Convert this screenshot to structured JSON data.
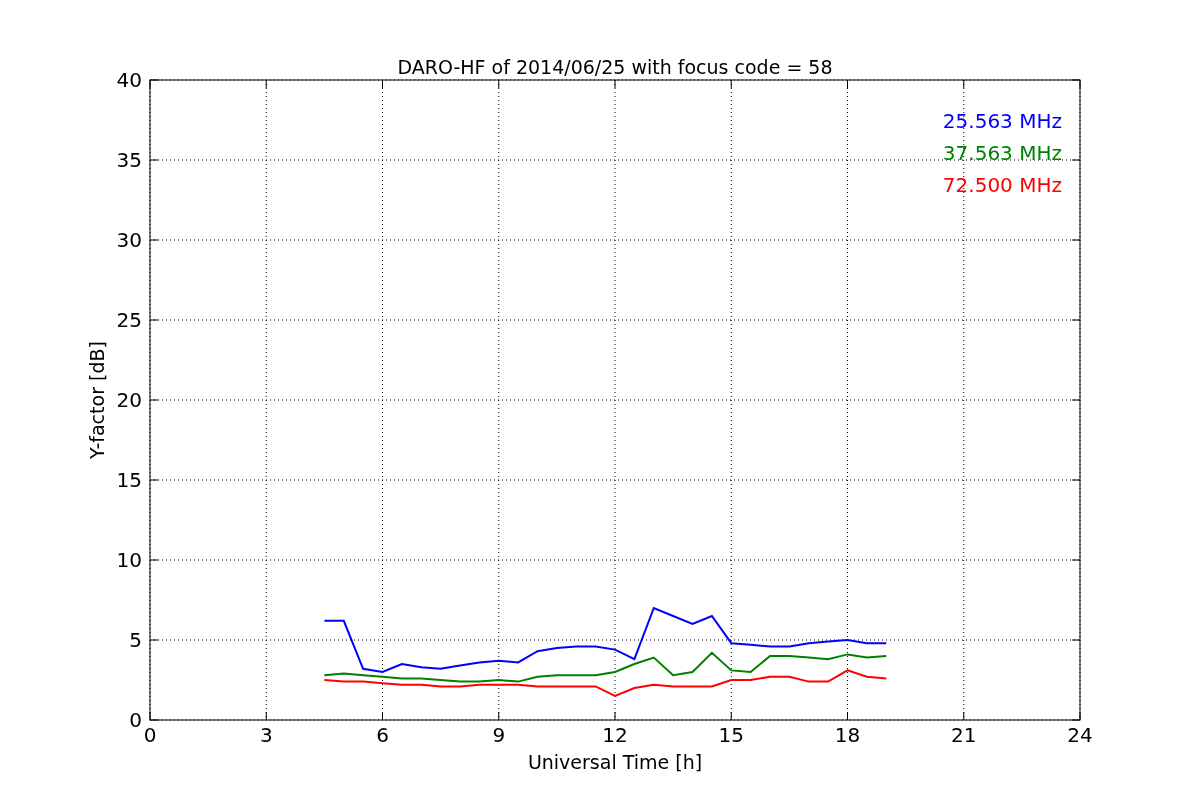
{
  "chart_data": {
    "type": "line",
    "title": "DARO-HF of 2014/06/25 with focus code = 58",
    "xlabel": "Universal Time [h]",
    "ylabel": "Y-factor [dB]",
    "x": [
      4.5,
      5,
      5.5,
      6,
      6.5,
      7,
      7.5,
      8,
      8.5,
      9,
      9.5,
      10,
      10.5,
      11,
      11.5,
      12,
      12.5,
      13,
      13.5,
      14,
      14.5,
      15,
      15.5,
      16,
      16.5,
      17,
      17.5,
      18,
      18.5,
      19
    ],
    "series": [
      {
        "name": "25.563 MHz",
        "color": "#0000ff",
        "values": [
          6.2,
          6.2,
          3.2,
          3.0,
          3.5,
          3.3,
          3.2,
          3.4,
          3.6,
          3.7,
          3.6,
          4.3,
          4.5,
          4.6,
          4.6,
          4.4,
          3.8,
          7.0,
          6.5,
          6.0,
          6.5,
          4.8,
          4.7,
          4.6,
          4.6,
          4.8,
          4.9,
          5.0,
          4.8,
          4.8
        ]
      },
      {
        "name": "37.563 MHz",
        "color": "#008000",
        "values": [
          2.8,
          2.9,
          2.8,
          2.7,
          2.6,
          2.6,
          2.5,
          2.4,
          2.4,
          2.5,
          2.4,
          2.7,
          2.8,
          2.8,
          2.8,
          3.0,
          3.5,
          3.9,
          2.8,
          3.0,
          4.2,
          3.1,
          3.0,
          4.0,
          4.0,
          3.9,
          3.8,
          4.1,
          3.9,
          4.0
        ]
      },
      {
        "name": "72.500 MHz",
        "color": "#ff0000",
        "values": [
          2.5,
          2.4,
          2.4,
          2.3,
          2.2,
          2.2,
          2.1,
          2.1,
          2.2,
          2.2,
          2.2,
          2.1,
          2.1,
          2.1,
          2.1,
          1.5,
          2.0,
          2.2,
          2.1,
          2.1,
          2.1,
          2.5,
          2.5,
          2.7,
          2.7,
          2.4,
          2.4,
          3.1,
          2.7,
          2.6
        ]
      }
    ],
    "grid": true,
    "xlim": [
      0,
      24
    ],
    "ylim": [
      0,
      40
    ],
    "xticks": [
      0,
      3,
      6,
      9,
      12,
      15,
      18,
      21,
      24
    ],
    "yticks": [
      0,
      5,
      10,
      15,
      20,
      25,
      30,
      35,
      40
    ]
  }
}
